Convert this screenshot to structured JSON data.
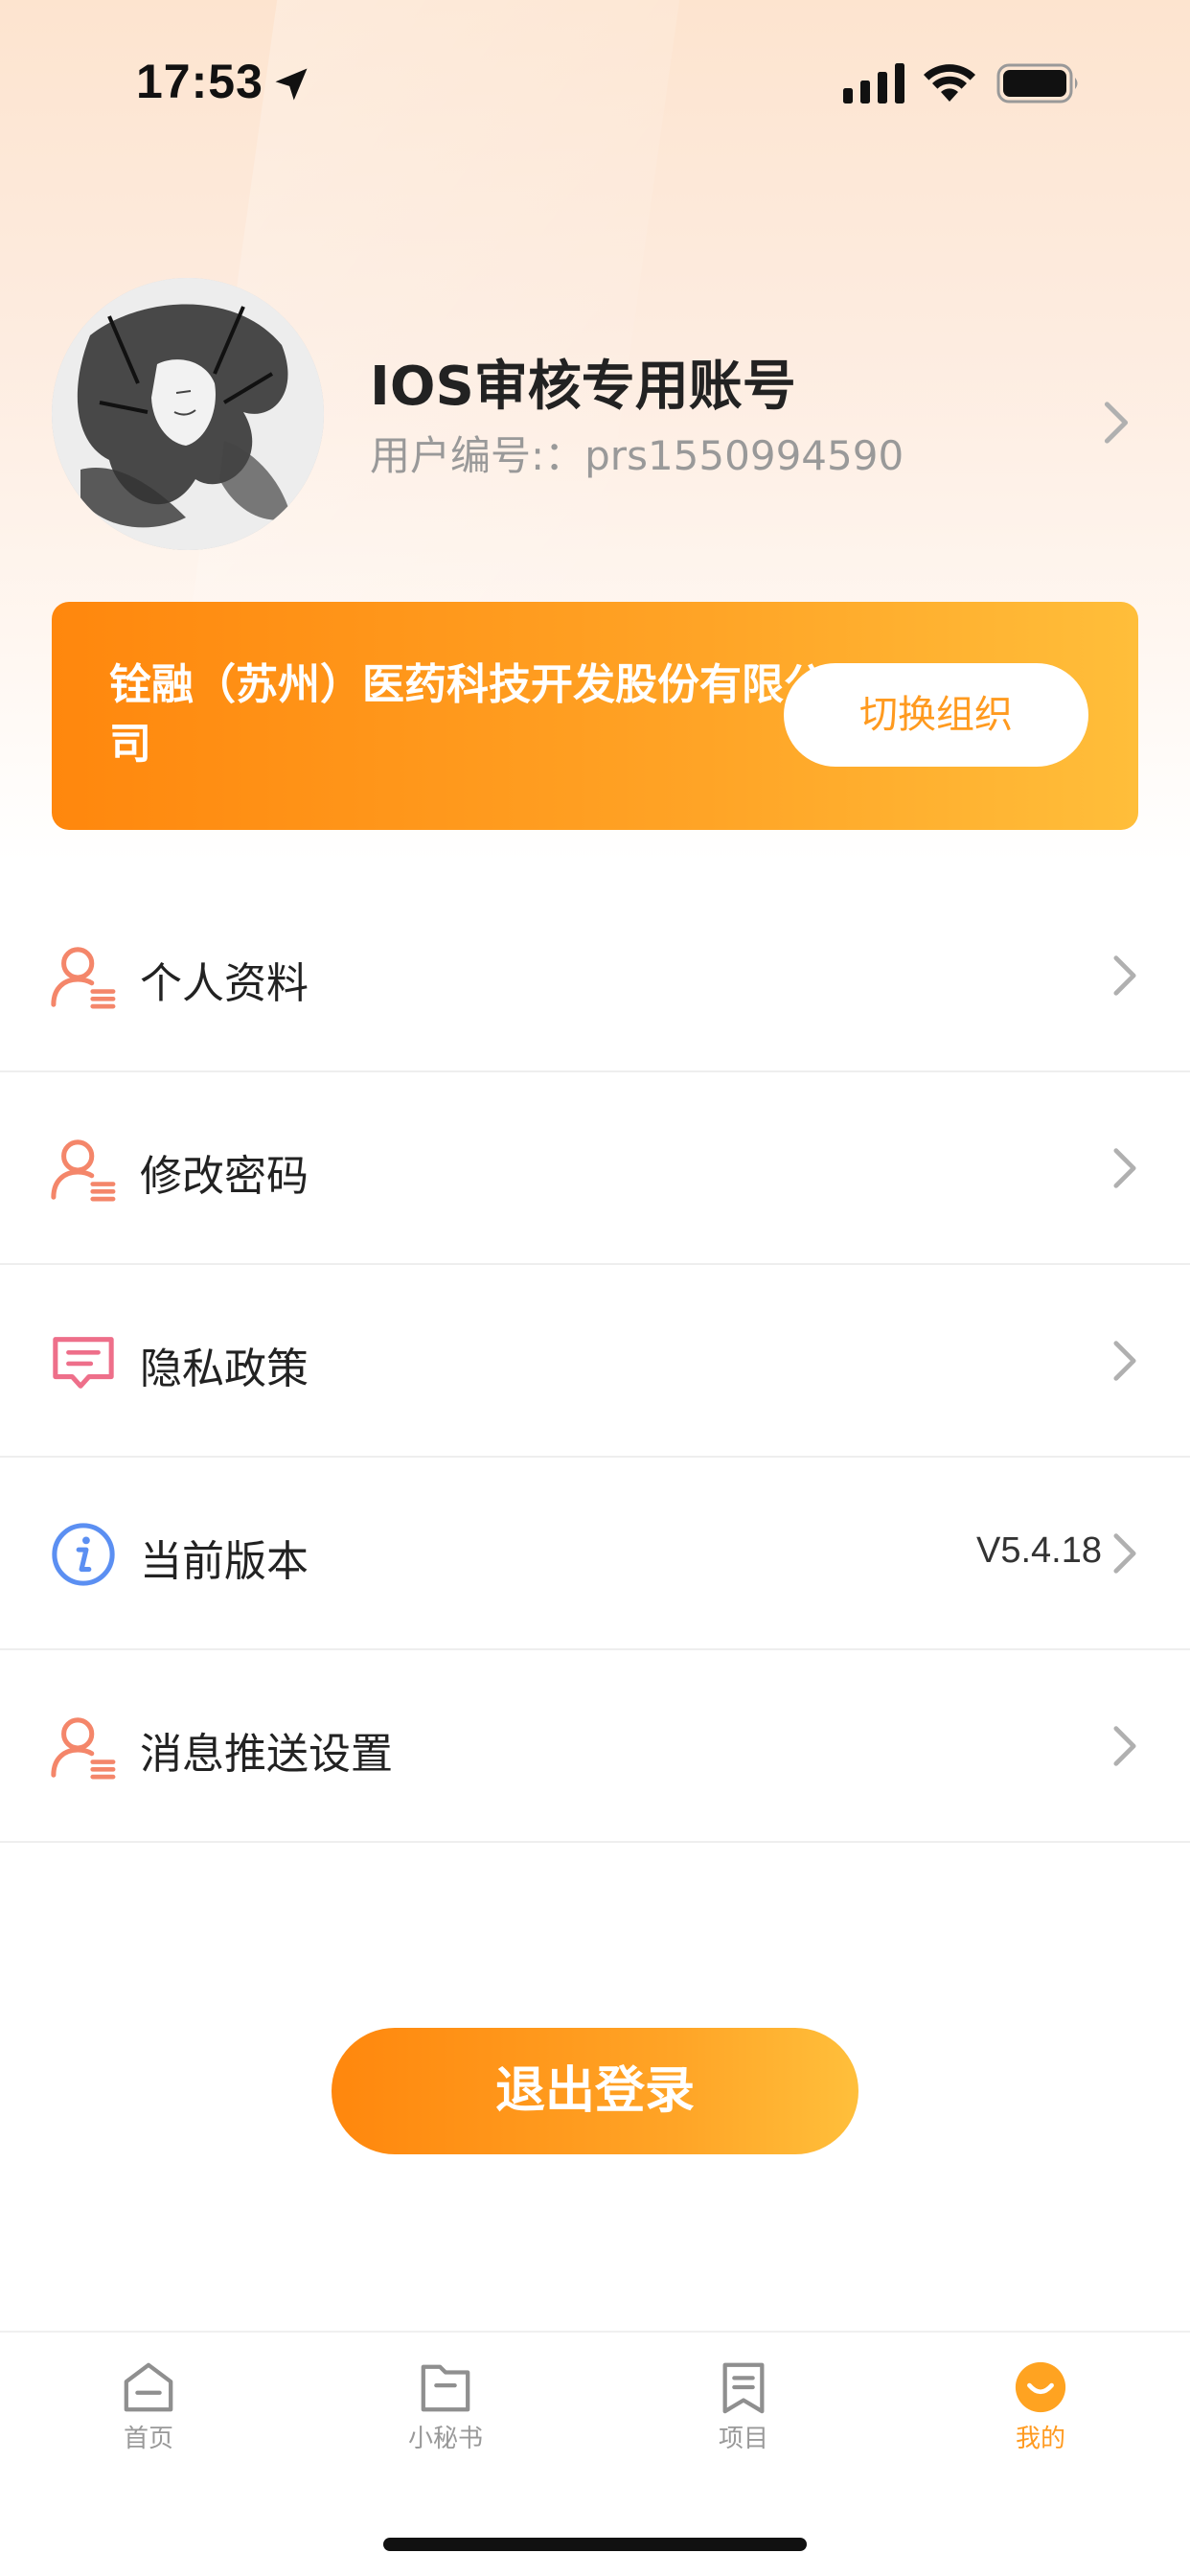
{
  "status_bar": {
    "time": "17:53",
    "icons": [
      "location-arrow-icon",
      "cellular-signal-icon",
      "wifi-icon",
      "battery-icon"
    ]
  },
  "profile": {
    "name": "IOS审核专用账号",
    "user_id": "用户编号:：prs1550994590",
    "avatar": "avatar-illustration"
  },
  "org_card": {
    "name": "铨融（苏州）医药科技开发股份有限公司",
    "switch_label": "切换组织"
  },
  "menu": {
    "items": [
      {
        "label": "个人资料",
        "icon": "user-list-icon",
        "value": ""
      },
      {
        "label": "修改密码",
        "icon": "user-list-icon",
        "value": ""
      },
      {
        "label": "隐私政策",
        "icon": "message-icon",
        "value": ""
      },
      {
        "label": "当前版本",
        "icon": "info-icon",
        "value": "V5.4.18"
      },
      {
        "label": "消息推送设置",
        "icon": "user-list-icon",
        "value": ""
      }
    ]
  },
  "logout_label": "退出登录",
  "tab_bar": {
    "tabs": [
      {
        "label": "首页",
        "icon": "home-icon",
        "active": false
      },
      {
        "label": "小秘书",
        "icon": "folder-icon",
        "active": false
      },
      {
        "label": "项目",
        "icon": "bookmark-icon",
        "active": false
      },
      {
        "label": "我的",
        "icon": "smile-icon",
        "active": true
      }
    ]
  },
  "colors": {
    "accent": "#ff9a1f",
    "gradient_start": "#ff870d",
    "gradient_end": "#ffbe3a",
    "icon_coral": "#f4866a",
    "icon_pink": "#ee6f8a",
    "icon_blue": "#5b8ff2"
  }
}
